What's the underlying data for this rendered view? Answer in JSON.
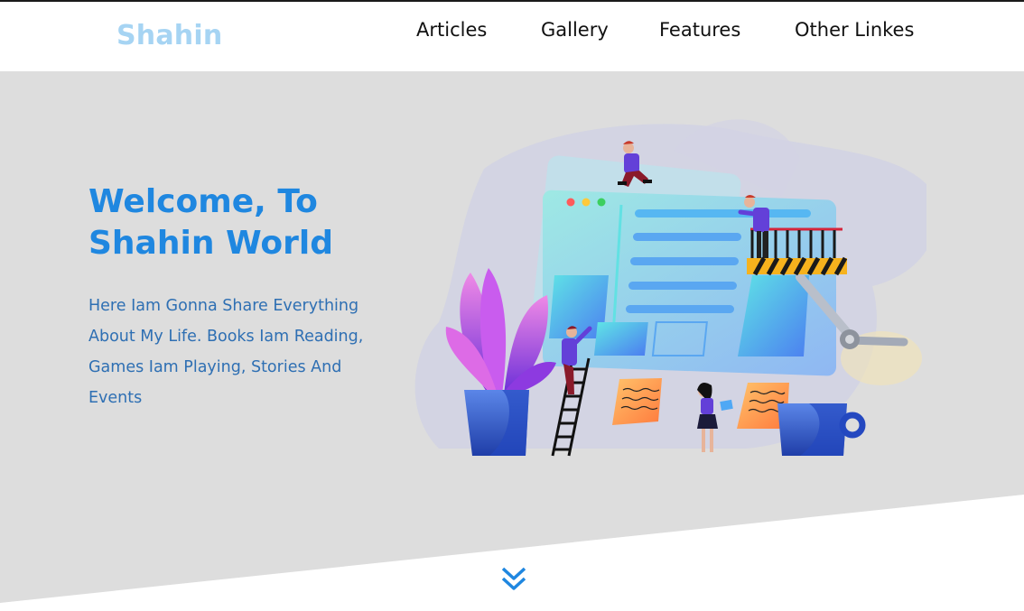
{
  "brand": {
    "name": "Shahin"
  },
  "nav": {
    "items": [
      {
        "label": "Articles"
      },
      {
        "label": "Gallery"
      },
      {
        "label": "Features"
      },
      {
        "label": "Other Linkes"
      }
    ]
  },
  "hero": {
    "title_line1": "Welcome, To",
    "title_line2": "Shahin World",
    "description": "Here Iam Gonna Share Everything About My Life. Books Iam Reading, Games Iam Playing, Stories And Events"
  },
  "icons": {
    "scroll_down": "double-chevron-down-icon",
    "illustration": "team-building-website-illustration"
  },
  "colors": {
    "accent": "#1f87e0",
    "logo": "#a6d4f3",
    "hero_bg": "#dddddd",
    "text": "#2e6fb3"
  }
}
